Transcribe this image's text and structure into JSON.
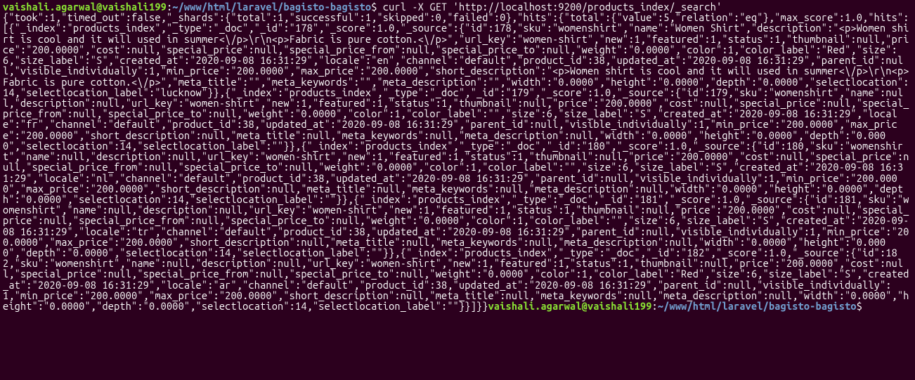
{
  "prompt1": {
    "userhost": "vaishali.agarwal@vaishali199",
    "colon": ":",
    "path": "~/www/html/laravel/bagisto-bagisto",
    "dollar": "$",
    "command": " curl -X GET 'http://localhost:9200/products_index/_search'"
  },
  "output": "{\"took\":1,\"timed_out\":false,\"_shards\":{\"total\":1,\"successful\":1,\"skipped\":0,\"failed\":0},\"hits\":{\"total\":{\"value\":5,\"relation\":\"eq\"},\"max_score\":1.0,\"hits\":[{\"_index\":\"products_index\",\"_type\":\"_doc\",\"_id\":\"178\",\"_score\":1.0,\"_source\":{\"id\":178,\"sku\":\"womenshirt\",\"name\":\"Women Shirt\",\"description\":\"<p>Women shirt is cool and it will used in summer<\\/p>\\r\\n<p>Fabric is pure cotton.<\\/p>\",\"url_key\":\"women-shirt\",\"new\":1,\"featured\":1,\"status\":1,\"thumbnail\":null,\"price\":\"200.0000\",\"cost\":null,\"special_price\":null,\"special_price_from\":null,\"special_price_to\":null,\"weight\":\"0.0000\",\"color\":1,\"color_label\":\"Red\",\"size\":6,\"size_label\":\"S\",\"created_at\":\"2020-09-08 16:31:29\",\"locale\":\"en\",\"channel\":\"default\",\"product_id\":38,\"updated_at\":\"2020-09-08 16:31:29\",\"parent_id\":null,\"visible_individually\":1,\"min_price\":\"200.0000\",\"max_price\":\"200.0000\",\"short_description\":\"<p>Women shirt is cool and it will used in summer<\\/p>\\r\\n<p>Fabric is pure cotton.<\\/p>\",\"meta_title\":\"\",\"meta_keywords\":\"\",\"meta_description\":\"\",\"width\":\"0.0000\",\"height\":\"0.0000\",\"depth\":\"0.0000\",\"selectlocation\":14,\"selectlocation_label\":\"lucknow\"}},{\"_index\":\"products_index\",\"_type\":\"_doc\",\"_id\":\"179\",\"_score\":1.0,\"_source\":{\"id\":179,\"sku\":\"womenshirt\",\"name\":null,\"description\":null,\"url_key\":\"women-shirt\",\"new\":1,\"featured\":1,\"status\":1,\"thumbnail\":null,\"price\":\"200.0000\",\"cost\":null,\"special_price\":null,\"special_price_from\":null,\"special_price_to\":null,\"weight\":\"0.0000\",\"color\":1,\"color_label\":\"\",\"size\":6,\"size_label\":\"S\",\"created_at\":\"2020-09-08 16:31:29\",\"locale\":\"fr\",\"channel\":\"default\",\"product_id\":38,\"updated_at\":\"2020-09-08 16:31:29\",\"parent_id\":null,\"visible_individually\":1,\"min_price\":\"200.0000\",\"max_price\":\"200.0000\",\"short_description\":null,\"meta_title\":null,\"meta_keywords\":null,\"meta_description\":null,\"width\":\"0.0000\",\"height\":\"0.0000\",\"depth\":\"0.0000\",\"selectlocation\":14,\"selectlocation_label\":\"\"}},{\"_index\":\"products_index\",\"_type\":\"_doc\",\"_id\":\"180\",\"_score\":1.0,\"_source\":{\"id\":180,\"sku\":\"womenshirt\",\"name\":null,\"description\":null,\"url_key\":\"women-shirt\",\"new\":1,\"featured\":1,\"status\":1,\"thumbnail\":null,\"price\":\"200.0000\",\"cost\":null,\"special_price\":null,\"special_price_from\":null,\"special_price_to\":null,\"weight\":\"0.0000\",\"color\":1,\"color_label\":\"\",\"size\":6,\"size_label\":\"S\",\"created_at\":\"2020-09-08 16:31:29\",\"locale\":\"nl\",\"channel\":\"default\",\"product_id\":38,\"updated_at\":\"2020-09-08 16:31:29\",\"parent_id\":null,\"visible_individually\":1,\"min_price\":\"200.0000\",\"max_price\":\"200.0000\",\"short_description\":null,\"meta_title\":null,\"meta_keywords\":null,\"meta_description\":null,\"width\":\"0.0000\",\"height\":\"0.0000\",\"depth\":\"0.0000\",\"selectlocation\":14,\"selectlocation_label\":\"\"}},{\"_index\":\"products_index\",\"_type\":\"_doc\",\"_id\":\"181\",\"_score\":1.0,\"_source\":{\"id\":181,\"sku\":\"womenshirt\",\"name\":null,\"description\":null,\"url_key\":\"women-shirt\",\"new\":1,\"featured\":1,\"status\":1,\"thumbnail\":null,\"price\":\"200.0000\",\"cost\":null,\"special_price\":null,\"special_price_from\":null,\"special_price_to\":null,\"weight\":\"0.0000\",\"color\":1,\"color_label\":\"\",\"size\":6,\"size_label\":\"S\",\"created_at\":\"2020-09-08 16:31:29\",\"locale\":\"tr\",\"channel\":\"default\",\"product_id\":38,\"updated_at\":\"2020-09-08 16:31:29\",\"parent_id\":null,\"visible_individually\":1,\"min_price\":\"200.0000\",\"max_price\":\"200.0000\",\"short_description\":null,\"meta_title\":null,\"meta_keywords\":null,\"meta_description\":null,\"width\":\"0.0000\",\"height\":\"0.0000\",\"depth\":\"0.0000\",\"selectlocation\":14,\"selectlocation_label\":\"\"}},{\"_index\":\"products_index\",\"_type\":\"_doc\",\"_id\":\"182\",\"_score\":1.0,\"_source\":{\"id\":182,\"sku\":\"womenshirt\",\"name\":null,\"description\":null,\"url_key\":\"women-shirt\",\"new\":1,\"featured\":1,\"status\":1,\"thumbnail\":null,\"price\":\"200.0000\",\"cost\":null,\"special_price\":null,\"special_price_from\":null,\"special_price_to\":null,\"weight\":\"0.0000\",\"color\":1,\"color_label\":\"Red\",\"size\":6,\"size_label\":\"S\",\"created_at\":\"2020-09-08 16:31:29\",\"locale\":\"ar\",\"channel\":\"default\",\"product_id\":38,\"updated_at\":\"2020-09-08 16:31:29\",\"parent_id\":null,\"visible_individually\":1,\"min_price\":\"200.0000\",\"max_price\":\"200.0000\",\"short_description\":null,\"meta_title\":null,\"meta_keywords\":null,\"meta_description\":null,\"width\":\"0.0000\",\"height\":\"0.0000\",\"depth\":\"0.0000\",\"selectlocation\":14,\"selectlocation_label\":\"\"}}]}}",
  "prompt2": {
    "userhost": "vaishali.agarwal@vaishali199",
    "colon": ":",
    "path": "~/www/html/laravel/bagisto-bagisto",
    "dollar": "$"
  }
}
